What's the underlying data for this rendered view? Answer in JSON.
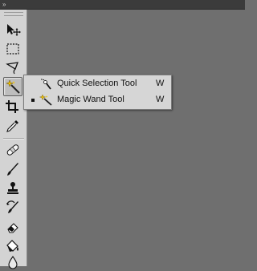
{
  "panel": {
    "collapse_glyph": "»"
  },
  "toolbar": {
    "tools": [
      {
        "name": "move-tool",
        "icon": "move-icon"
      },
      {
        "name": "rectangular-marquee-tool",
        "icon": "marquee-icon"
      },
      {
        "name": "lasso-tool",
        "icon": "lasso-icon"
      },
      {
        "name": "magic-wand-tool",
        "icon": "magic-wand-icon",
        "active": true
      },
      {
        "name": "crop-tool",
        "icon": "crop-icon"
      },
      {
        "name": "eyedropper-tool",
        "icon": "eyedropper-icon"
      },
      {
        "name": "spot-healing-brush-tool",
        "icon": "bandage-icon"
      },
      {
        "name": "brush-tool",
        "icon": "brush-icon"
      },
      {
        "name": "clone-stamp-tool",
        "icon": "stamp-icon"
      },
      {
        "name": "history-brush-tool",
        "icon": "history-brush-icon"
      },
      {
        "name": "eraser-tool",
        "icon": "eraser-icon"
      },
      {
        "name": "paint-bucket-tool",
        "icon": "bucket-icon"
      },
      {
        "name": "blur-tool",
        "icon": "drop-icon"
      }
    ]
  },
  "flyout": {
    "items": [
      {
        "label": "Quick Selection Tool",
        "shortcut": "W",
        "selected": false,
        "icon": "quick-selection-icon"
      },
      {
        "label": "Magic Wand Tool",
        "shortcut": "W",
        "selected": true,
        "icon": "magic-wand-icon"
      }
    ]
  },
  "colors": {
    "canvas": "#6f6f6f",
    "toolbar": "#d3d3d3",
    "flyout": "#d6d6d6"
  }
}
